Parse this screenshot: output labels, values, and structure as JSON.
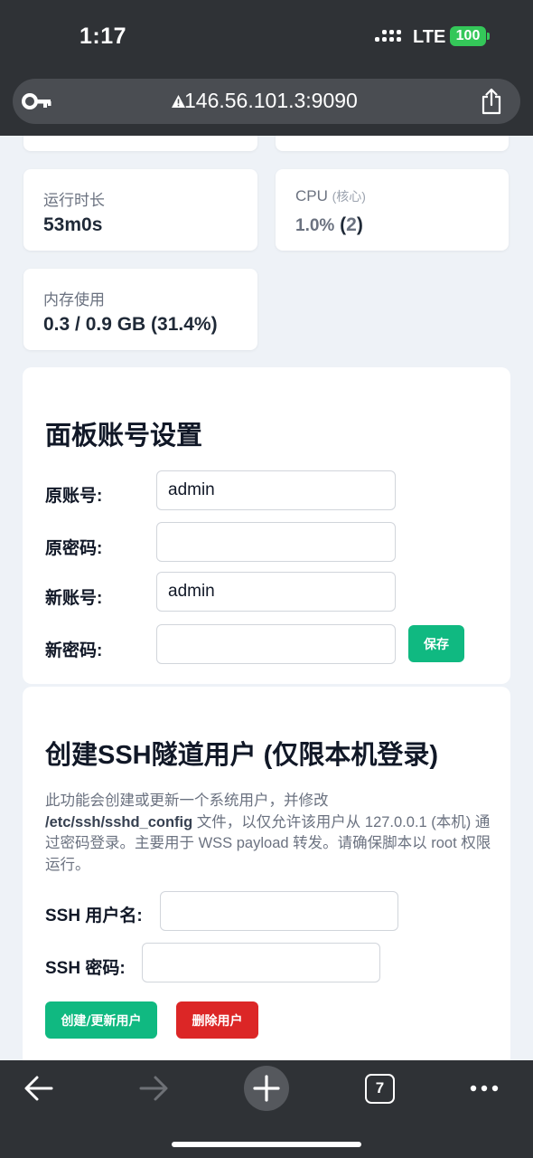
{
  "status_bar": {
    "time": "1:17",
    "network": "LTE",
    "battery": "100"
  },
  "browser": {
    "url": "146.56.101.3:9090",
    "open_tabs": "7",
    "icons": [
      "key-icon",
      "warning-icon",
      "share-icon",
      "back-icon",
      "forward-icon",
      "plus-icon",
      "tabs-icon",
      "more-icon"
    ]
  },
  "stats": {
    "uptime": {
      "label": "运行时长",
      "value": "53m0s"
    },
    "cpu": {
      "label": "CPU",
      "label_note": "(核心)",
      "usage": "1.0%",
      "cores": "2"
    },
    "memory": {
      "label": "内存使用",
      "value": "0.3 / 0.9 GB (31.4%)"
    }
  },
  "account_panel": {
    "title": "面板账号设置",
    "old_user_label": "原账号:",
    "old_user_value": "admin",
    "old_pass_label": "原密码:",
    "old_pass_value": "",
    "new_user_label": "新账号:",
    "new_user_value": "admin",
    "new_pass_label": "新密码:",
    "new_pass_value": "",
    "save_label": "保存"
  },
  "ssh_panel": {
    "title": "创建SSH隧道用户 (仅限本机登录)",
    "desc_part1": "此功能会创建或更新一个系统用户，并修改",
    "desc_path": "/etc/ssh/sshd_config",
    "desc_part2": " 文件，以仅允许该用户从 127.0.0.1 (本机) 通过密码登录。主要用于 WSS payload 转发。请确保脚本以 root 权限运行。",
    "username_label": "SSH 用户名:",
    "username_value": "",
    "password_label": "SSH 密码:",
    "password_value": "",
    "create_label": "创建/更新用户",
    "delete_label": "删除用户"
  },
  "colors": {
    "accent_green": "#10b981",
    "danger_red": "#dc2626",
    "page_bg": "#eef2f7",
    "chrome_bg": "#2f3236"
  }
}
